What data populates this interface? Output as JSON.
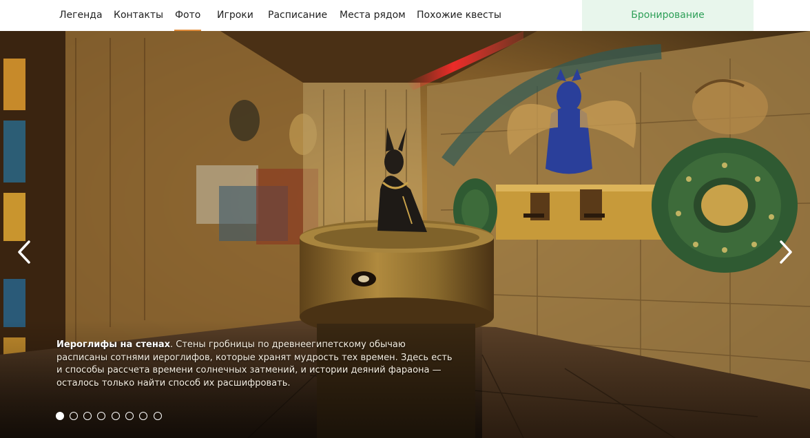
{
  "nav": {
    "items": [
      {
        "label": "Легенда",
        "active": false
      },
      {
        "label": "Контакты",
        "active": false
      },
      {
        "label": "Фото",
        "active": true
      },
      {
        "label": "Игроки",
        "active": false
      },
      {
        "label": "Расписание",
        "active": false
      },
      {
        "label": "Места рядом",
        "active": false
      },
      {
        "label": "Похожие квесты",
        "active": false
      }
    ],
    "booking_label": "Бронирование"
  },
  "slider": {
    "caption": {
      "title": "Иероглифы на стенах",
      "text": ". Стены гробницы по древнеегипетскому обычаю расписаны сотнями иероглифов, которые хранят мудрость тех времен. Здесь есть и способы рассчета времени солнечных затмений, и истории деяний фараона — осталось только найти способ их расшифровать."
    },
    "slide_count": 8,
    "active_slide": 1,
    "prev_icon": "chevron-left-icon",
    "next_icon": "chevron-right-icon"
  },
  "colors": {
    "active_tab_underline": "#e08b3a",
    "booking_bg": "#e8f6ec",
    "booking_text": "#2d9f57"
  }
}
